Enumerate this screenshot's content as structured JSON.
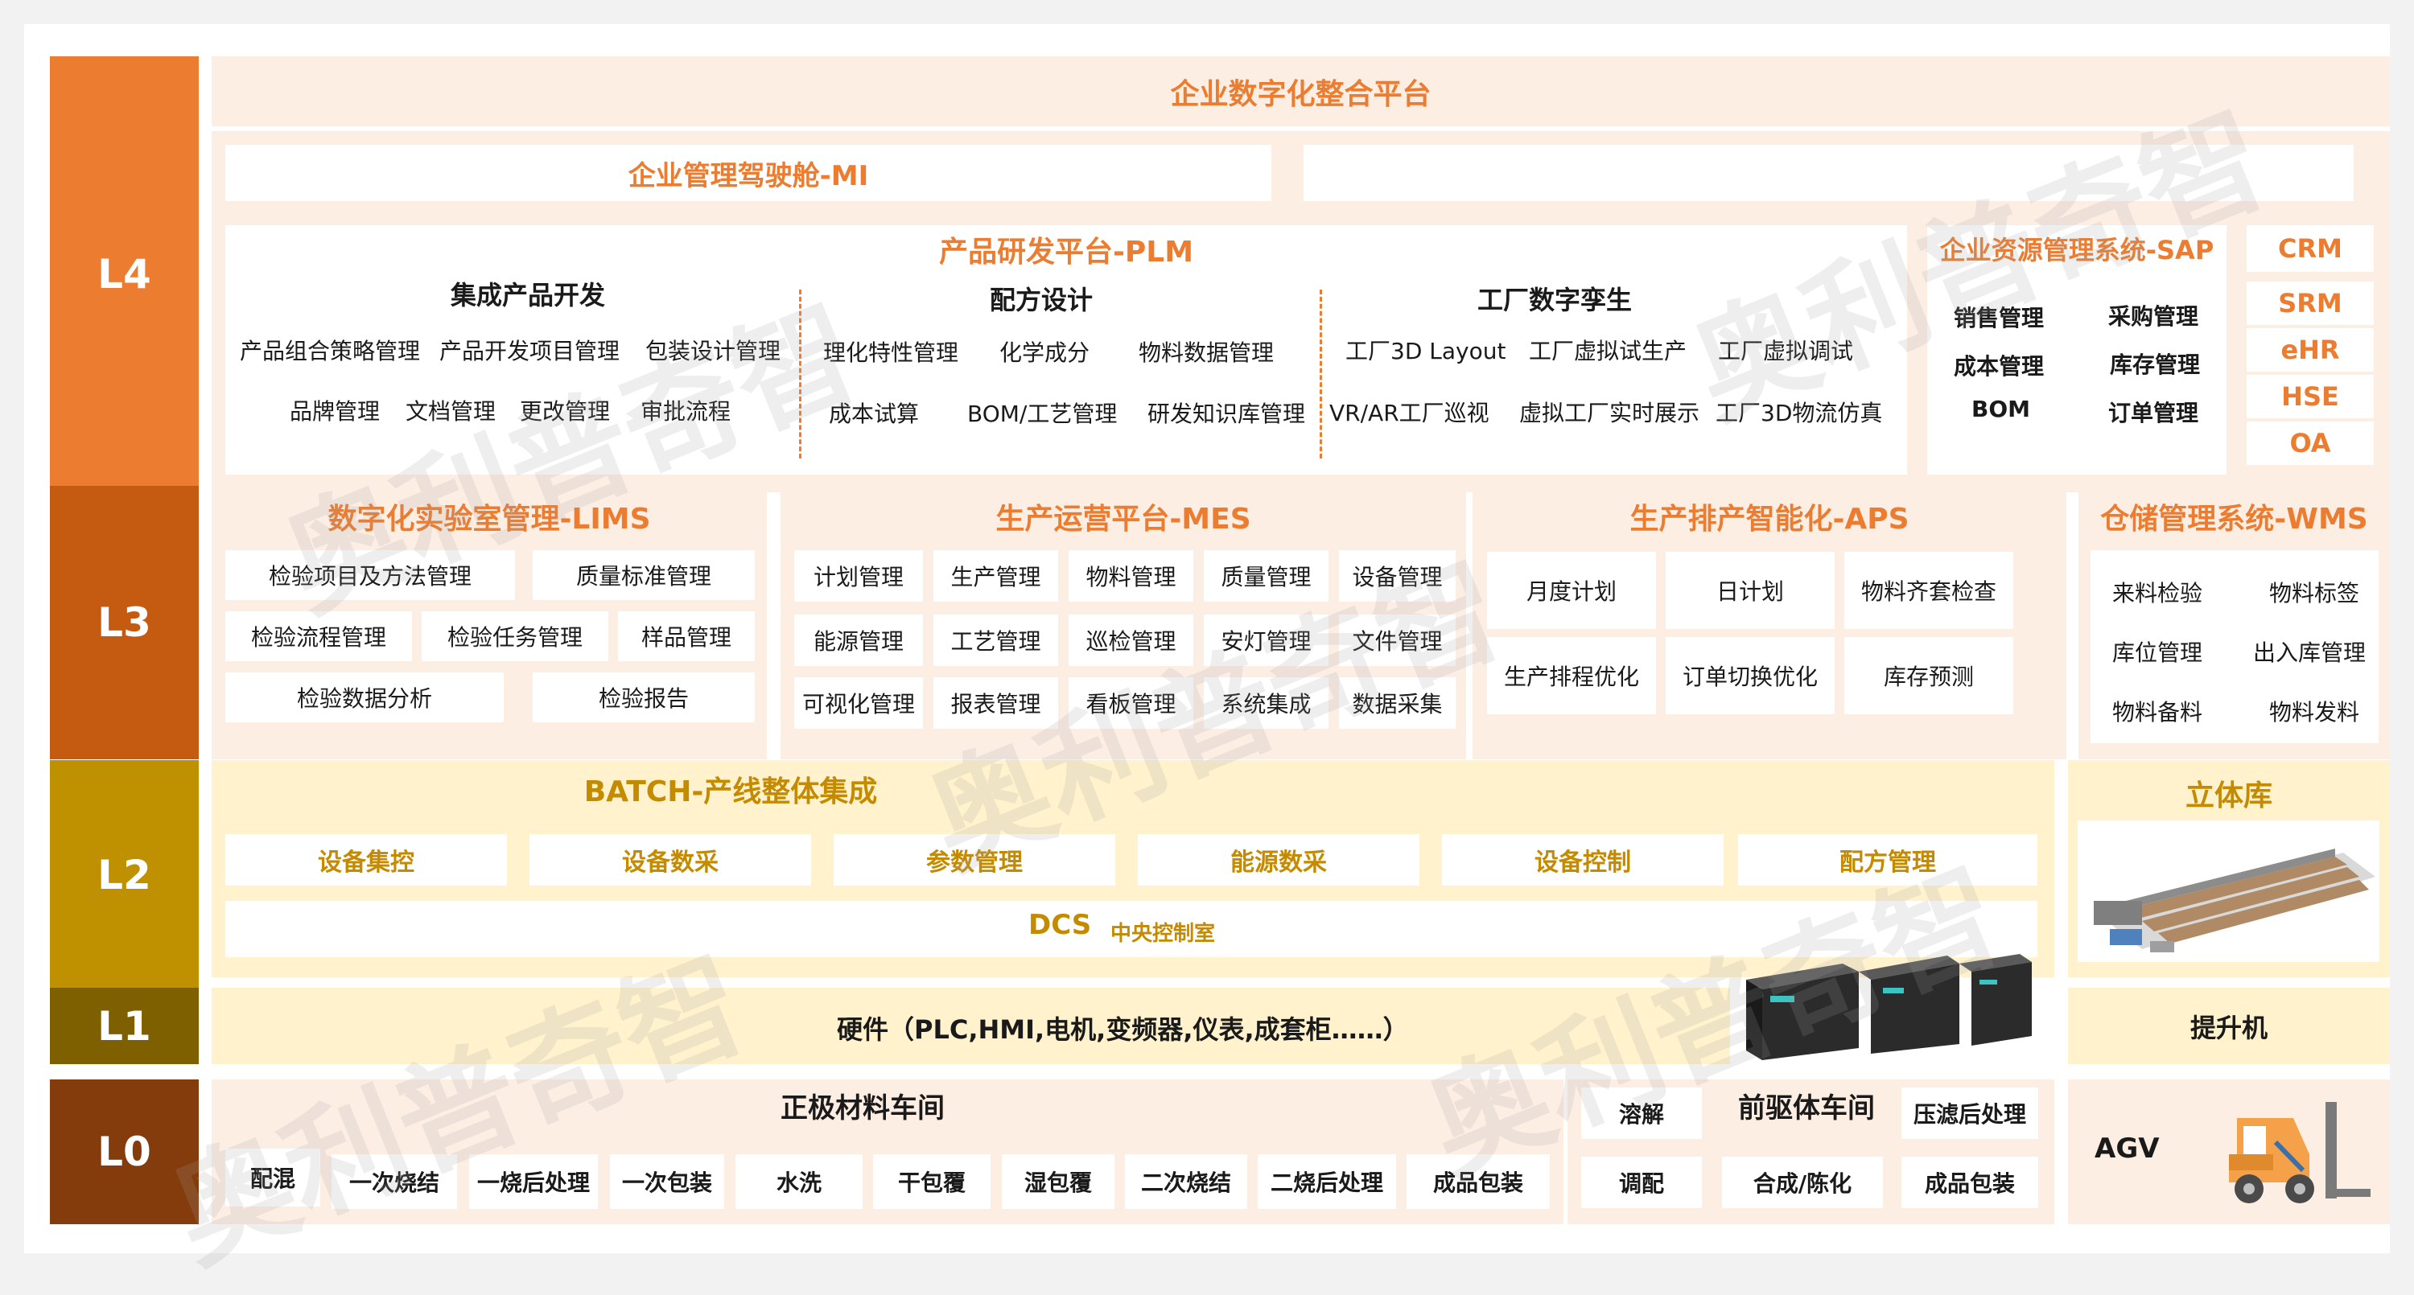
{
  "levels": {
    "l4": "L4",
    "l3": "L3",
    "l2": "L2",
    "l1": "L1",
    "l0": "L0"
  },
  "colors": {
    "l4": "#ec7c30",
    "l3": "#c55a11",
    "l2": "#bf9000",
    "l1": "#7f6000",
    "l0": "#843c0c",
    "accent": "#ec7c30",
    "gold": "#c48a00"
  },
  "l4": {
    "platform_title": "企业数字化整合平台",
    "mi_title": "企业管理驾驶舱-MI",
    "plm": {
      "title": "产品研发平台-PLM",
      "groups": [
        {
          "title": "集成产品开发",
          "row1": [
            "产品组合策略管理",
            "产品开发项目管理",
            "包装设计管理"
          ],
          "row2": [
            "品牌管理",
            "文档管理",
            "更改管理",
            "审批流程"
          ]
        },
        {
          "title": "配方设计",
          "row1": [
            "理化特性管理",
            "化学成分",
            "物料数据管理"
          ],
          "row2": [
            "成本试算",
            "BOM/工艺管理",
            "研发知识库管理"
          ]
        },
        {
          "title": "工厂数字孪生",
          "row1": [
            "工厂3D Layout",
            "工厂虚拟试生产",
            "工厂虚拟调试"
          ],
          "row2": [
            "VR/AR工厂巡视",
            "虚拟工厂实时展示",
            "工厂3D物流仿真"
          ]
        }
      ]
    },
    "sap": {
      "title": "企业资源管理系统-SAP",
      "items": [
        "销售管理",
        "采购管理",
        "成本管理",
        "库存管理",
        "BOM",
        "订单管理"
      ]
    },
    "side": [
      "CRM",
      "SRM",
      "eHR",
      "HSE",
      "OA"
    ]
  },
  "l3": {
    "lims": {
      "title": "数字化实验室管理-LIMS",
      "items": [
        "检验项目及方法管理",
        "质量标准管理",
        "检验流程管理",
        "检验任务管理",
        "样品管理",
        "检验数据分析",
        "检验报告"
      ]
    },
    "mes": {
      "title": "生产运营平台-MES",
      "items": [
        "计划管理",
        "生产管理",
        "物料管理",
        "质量管理",
        "设备管理",
        "能源管理",
        "工艺管理",
        "巡检管理",
        "安灯管理",
        "文件管理",
        "可视化管理",
        "报表管理",
        "看板管理",
        "系统集成",
        "数据采集"
      ]
    },
    "aps": {
      "title": "生产排产智能化-APS",
      "items": [
        "月度计划",
        "日计划",
        "物料齐套检查",
        "生产排程优化",
        "订单切换优化",
        "库存预测"
      ]
    },
    "wms": {
      "title": "仓储管理系统-WMS",
      "items": [
        "来料检验",
        "物料标签",
        "库位管理",
        "出入库管理",
        "物料备料",
        "物料发料"
      ]
    }
  },
  "l2": {
    "batch_title": "BATCH-产线整体集成",
    "items": [
      "设备集控",
      "设备数采",
      "参数管理",
      "能源数采",
      "设备控制",
      "配方管理"
    ],
    "dcs": "DCS",
    "dcs_sub": "中央控制室",
    "warehouse": "立体库"
  },
  "l1": {
    "hardware": "硬件（PLC,HMI,电机,变频器,仪表,成套柜……）",
    "lift": "提升机"
  },
  "l0": {
    "cathode": {
      "title": "正极材料车间",
      "items": [
        "配混",
        "一次烧结",
        "一烧后处理",
        "一次包装",
        "水洗",
        "干包覆",
        "湿包覆",
        "二次烧结",
        "二烧后处理",
        "成品包装"
      ]
    },
    "precursor": {
      "title": "前驱体车间",
      "items": [
        "溶解",
        "压滤后处理",
        "调配",
        "合成/陈化",
        "成品包装"
      ]
    },
    "agv": "AGV"
  },
  "watermark": "奥利普奇智",
  "icons": {
    "plc": "plc-rack-icon",
    "warehouse": "warehouse-3d-icon",
    "forklift": "forklift-icon"
  }
}
